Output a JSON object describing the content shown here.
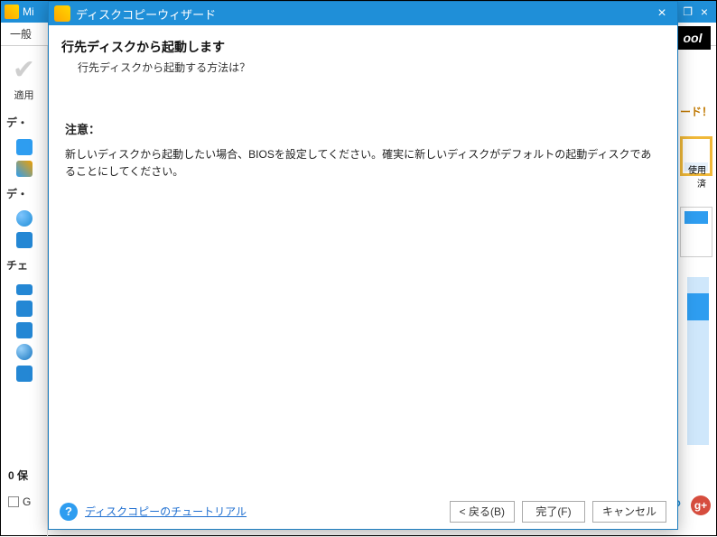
{
  "parent": {
    "title_fragment": "Mi",
    "win_minimize": "—",
    "win_maxrestore": "❐",
    "win_close": "×",
    "toolbar": {
      "item_general": "一般"
    },
    "logo_fragment": "ool",
    "apply_label": "適用",
    "side_heads": {
      "disk_a": "デ・",
      "disk_b": "デ・",
      "check": "チェ"
    },
    "pending_label": "0 保",
    "g_label": "G",
    "right": {
      "wizard_suffix": "ード！",
      "usage_label": "使用済"
    }
  },
  "modal": {
    "title": "ディスクコピーウィザード",
    "close": "×",
    "heading": "行先ディスクから起動します",
    "subheading": "行先ディスクから起動する方法は？",
    "note_heading": "注意：",
    "note_body": "新しいディスクから起動したい場合、BIOSを設定してください。確実に新しいディスクがデフォルトの起動ディスクであることにしてください。",
    "tutorial_link": "ディスクコピーのチュートリアル",
    "back": "< 戻る(B)",
    "finish": "完了(F)",
    "cancel": "キャンセル"
  },
  "gplus": "g+"
}
